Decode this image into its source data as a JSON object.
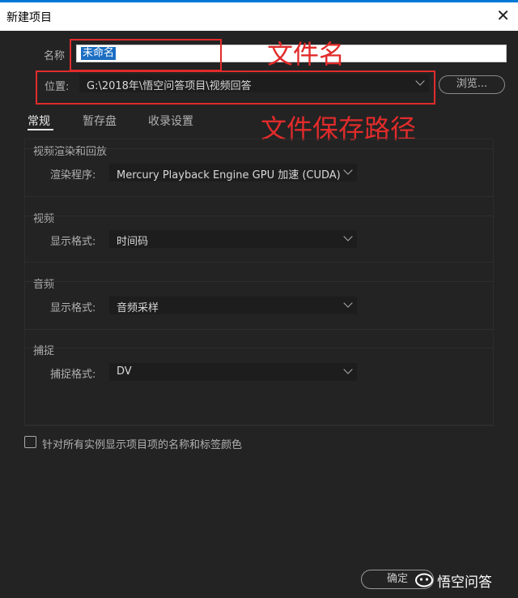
{
  "window": {
    "title": "新建项目",
    "close_glyph": "✕"
  },
  "name_field": {
    "label": "名称",
    "value": "未命名"
  },
  "location": {
    "label": "位置:",
    "value": "G:\\2018年\\悟空问答项目\\视频回答",
    "browse_label": "浏览..."
  },
  "annotations": {
    "filename": "文件名",
    "save_path": "文件保存路径",
    "color": "#e22b2b"
  },
  "tabs": [
    {
      "label": "常规",
      "active": true
    },
    {
      "label": "暂存盘",
      "active": false
    },
    {
      "label": "收录设置",
      "active": false
    }
  ],
  "sections": {
    "render": {
      "title": "视频渲染和回放",
      "field_label": "渲染程序:",
      "value": "Mercury Playback Engine GPU 加速 (CUDA)"
    },
    "video": {
      "title": "视频",
      "field_label": "显示格式:",
      "value": "时间码"
    },
    "audio": {
      "title": "音频",
      "field_label": "显示格式:",
      "value": "音频采样"
    },
    "capture": {
      "title": "捕捉",
      "field_label": "捕捉格式:",
      "value": "DV"
    }
  },
  "checkbox": {
    "label": "针对所有实例显示项目项的名称和标签颜色",
    "checked": false
  },
  "footer": {
    "ok_label": "确定",
    "watermark": "悟空问答"
  },
  "colors": {
    "background": "#232323",
    "field": "#1d1d1d",
    "accent_selection": "#1b6ec2"
  }
}
